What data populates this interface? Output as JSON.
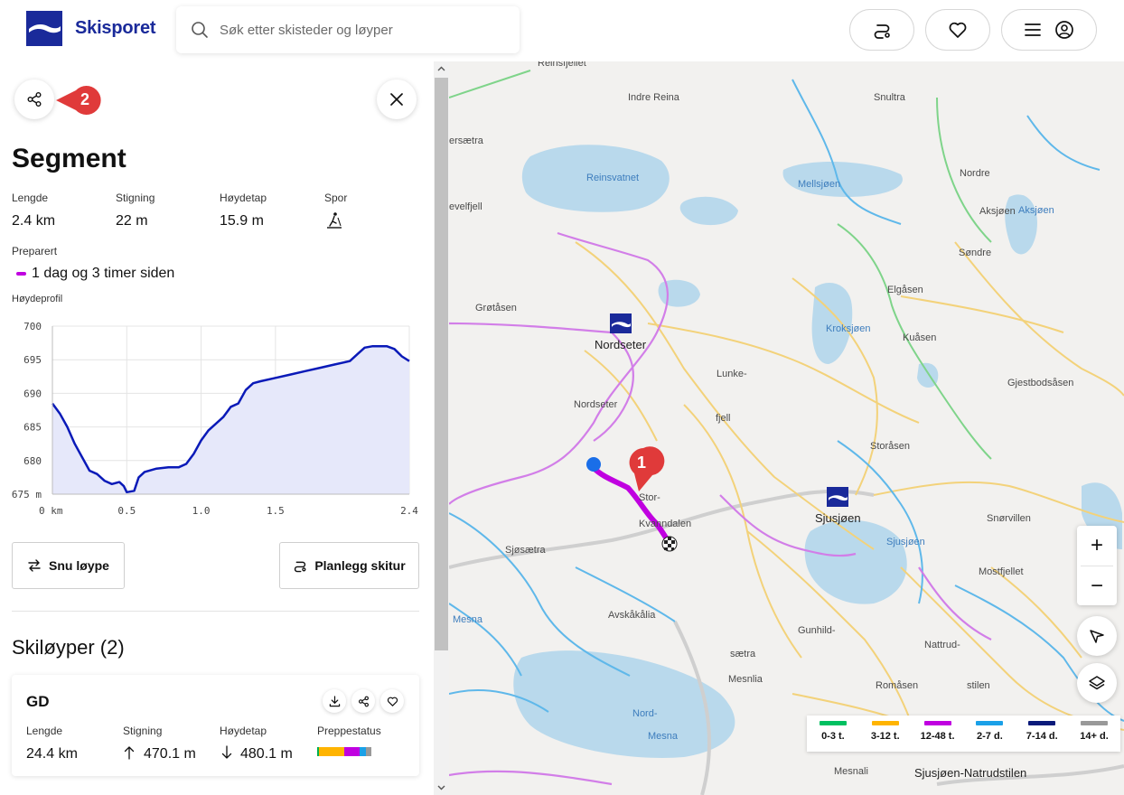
{
  "header": {
    "brand": "Skisporet",
    "search_placeholder": "Søk etter skisteder og løyper",
    "route_icon": "route-icon",
    "favorite_icon": "heart-icon",
    "menu_icon": "menu-icon",
    "account_icon": "user-icon"
  },
  "segment": {
    "title": "Segment",
    "stats": [
      {
        "label": "Lengde",
        "value": "2.4 km"
      },
      {
        "label": "Stigning",
        "value": "22 m"
      },
      {
        "label": "Høydetap",
        "value": "15.9 m"
      },
      {
        "label": "Spor",
        "value": ""
      }
    ],
    "preparation_label": "Preparert",
    "preparation_value": "1 dag og 3 timer siden",
    "preparation_color": "#c000e0",
    "elevation_label": "Høydeprofil",
    "marker_2": "2"
  },
  "chart_data": {
    "type": "area",
    "title": "",
    "xlabel": "",
    "ylabel": "",
    "x_unit": "km",
    "y_unit": "m",
    "xlim": [
      0,
      2.4
    ],
    "ylim": [
      675,
      700
    ],
    "x_ticks": [
      0,
      0.5,
      1.0,
      1.5,
      2.4
    ],
    "x_tick_labels": [
      "0 km",
      "0.5",
      "1.0",
      "1.5",
      "2.4"
    ],
    "y_ticks": [
      675,
      680,
      685,
      690,
      695,
      700
    ],
    "y_tick_labels": [
      "675 m",
      "680",
      "685",
      "690",
      "695",
      "700"
    ],
    "grid": true,
    "line_color": "#0a1ab8",
    "fill_color": "#e6e8fa",
    "x": [
      0,
      0.05,
      0.1,
      0.15,
      0.2,
      0.25,
      0.3,
      0.35,
      0.4,
      0.45,
      0.48,
      0.5,
      0.55,
      0.58,
      0.62,
      0.7,
      0.78,
      0.85,
      0.9,
      0.95,
      1.0,
      1.05,
      1.1,
      1.15,
      1.2,
      1.25,
      1.3,
      1.35,
      1.4,
      1.5,
      1.6,
      1.7,
      1.8,
      1.9,
      2.0,
      2.05,
      2.1,
      2.15,
      2.2,
      2.25,
      2.3,
      2.35,
      2.4
    ],
    "y": [
      688.5,
      687,
      685,
      682.5,
      680.5,
      678.5,
      678,
      677,
      676.5,
      676.8,
      676.2,
      675.3,
      675.5,
      677.5,
      678.3,
      678.8,
      679,
      679,
      679.5,
      681,
      683,
      684.5,
      685.5,
      686.5,
      688,
      688.5,
      690.5,
      691.5,
      691.8,
      692.3,
      692.8,
      693.3,
      693.8,
      694.3,
      694.8,
      695.8,
      696.8,
      697,
      697,
      697,
      696.6,
      695.5,
      694.8
    ]
  },
  "actions": {
    "reverse_label": "Snu løype",
    "plan_label": "Planlegg skitur"
  },
  "trails": {
    "section_title": "Skiløyper (2)",
    "cards": [
      {
        "name": "GD",
        "length_label": "Lengde",
        "length_value": "24.4 km",
        "ascent_label": "Stigning",
        "ascent_value": "470.1 m",
        "descent_label": "Høydetap",
        "descent_value": "480.1 m",
        "prep_label": "Preppestatus",
        "prep_status": [
          {
            "color": "#00b050",
            "fraction": 0.04
          },
          {
            "color": "#ffb400",
            "fraction": 0.46
          },
          {
            "color": "#c000e0",
            "fraction": 0.28
          },
          {
            "color": "#1aa0e8",
            "fraction": 0.12
          },
          {
            "color": "#999999",
            "fraction": 0.1
          }
        ]
      }
    ]
  },
  "map": {
    "labels": [
      {
        "text": "Reinsfjellet",
        "type": "place"
      },
      {
        "text": "Indre Reina",
        "type": "place"
      },
      {
        "text": "Snultra",
        "type": "place"
      },
      {
        "text": "ersætra",
        "type": "place"
      },
      {
        "text": "Reinsvatnet",
        "type": "water"
      },
      {
        "text": "Mellsjøen",
        "type": "water"
      },
      {
        "text": "Nordre",
        "type": "place"
      },
      {
        "text": "evelfjell",
        "type": "place"
      },
      {
        "text": "Aksjøen",
        "type": "place"
      },
      {
        "text": "Aksjøen",
        "type": "water"
      },
      {
        "text": "Søndre",
        "type": "place"
      },
      {
        "text": "Grøtåsen",
        "type": "place"
      },
      {
        "text": "Elgåsen",
        "type": "place"
      },
      {
        "text": "Nordseter",
        "type": "resort"
      },
      {
        "text": "Kroksjøen",
        "type": "water"
      },
      {
        "text": "Kuåsen",
        "type": "place"
      },
      {
        "text": "Lunke-",
        "type": "place"
      },
      {
        "text": "Gjestbodsåsen",
        "type": "place"
      },
      {
        "text": "Nordseter",
        "type": "place"
      },
      {
        "text": "fjell",
        "type": "place"
      },
      {
        "text": "Storåsen",
        "type": "place"
      },
      {
        "text": "Stor-",
        "type": "place"
      },
      {
        "text": "Kvanndalen",
        "type": "place"
      },
      {
        "text": "Sjusjøen",
        "type": "resort"
      },
      {
        "text": "Snørvillen",
        "type": "place"
      },
      {
        "text": "Sjøsætra",
        "type": "place"
      },
      {
        "text": "Sjusjøen",
        "type": "water"
      },
      {
        "text": "Mostfjellet",
        "type": "place"
      },
      {
        "text": "Mesna",
        "type": "water"
      },
      {
        "text": "Avskåkålia",
        "type": "place"
      },
      {
        "text": "Gunhild-",
        "type": "place"
      },
      {
        "text": "sætra",
        "type": "place"
      },
      {
        "text": "Nattrud-",
        "type": "place"
      },
      {
        "text": "Mesnlia",
        "type": "place"
      },
      {
        "text": "Romåsen",
        "type": "place"
      },
      {
        "text": "stilen",
        "type": "place"
      },
      {
        "text": "Nord-",
        "type": "water"
      },
      {
        "text": "Mesna",
        "type": "water"
      },
      {
        "text": "Mesnali",
        "type": "place"
      },
      {
        "text": "Sjusjøen-Natrudstilen",
        "type": "place"
      }
    ],
    "marker_1": "1",
    "zoom_in": "+",
    "zoom_out": "−",
    "legend": [
      {
        "label": "0-3 t.",
        "color": "#00c060"
      },
      {
        "label": "3-12 t.",
        "color": "#ffb400"
      },
      {
        "label": "12-48 t.",
        "color": "#c000e0"
      },
      {
        "label": "2-7 d.",
        "color": "#1aa0e8"
      },
      {
        "label": "7-14 d.",
        "color": "#0a1a7a"
      },
      {
        "label": "14+ d.",
        "color": "#999999"
      }
    ]
  }
}
